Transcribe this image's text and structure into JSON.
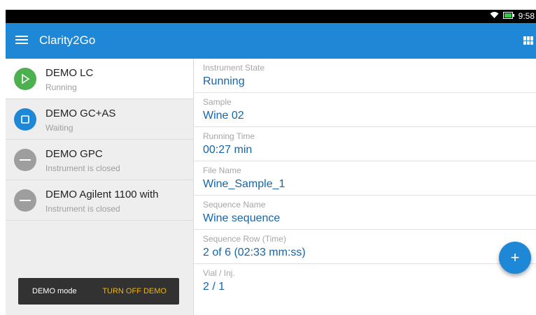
{
  "status_bar": {
    "time": "9:58"
  },
  "app_bar": {
    "title": "Clarity2Go"
  },
  "instruments": [
    {
      "name": "DEMO LC",
      "status": "Running",
      "icon": "play-icon",
      "color": "#4caf50"
    },
    {
      "name": "DEMO GC+AS",
      "status": "Waiting",
      "icon": "stop-icon",
      "color": "#1e88d6"
    },
    {
      "name": "DEMO GPC",
      "status": "Instrument is closed",
      "icon": "closed-icon",
      "color": "#9e9e9e"
    },
    {
      "name": "DEMO Agilent 1100 with",
      "status": "Instrument is closed",
      "icon": "closed-icon",
      "color": "#9e9e9e"
    }
  ],
  "demo_bar": {
    "label": "DEMO mode",
    "button": "TURN OFF DEMO"
  },
  "details": [
    {
      "label": "Instrument State",
      "value": "Running"
    },
    {
      "label": "Sample",
      "value": "Wine 02"
    },
    {
      "label": "Running Time",
      "value": "00:27 min"
    },
    {
      "label": "File Name",
      "value": "Wine_Sample_1"
    },
    {
      "label": "Sequence Name",
      "value": "Wine sequence"
    },
    {
      "label": "Sequence Row (Time)",
      "value": "2 of 6 (02:33 mm:ss)"
    },
    {
      "label": "Vial / Inj.",
      "value": "2 / 1"
    }
  ],
  "fab": {
    "label": "+"
  }
}
